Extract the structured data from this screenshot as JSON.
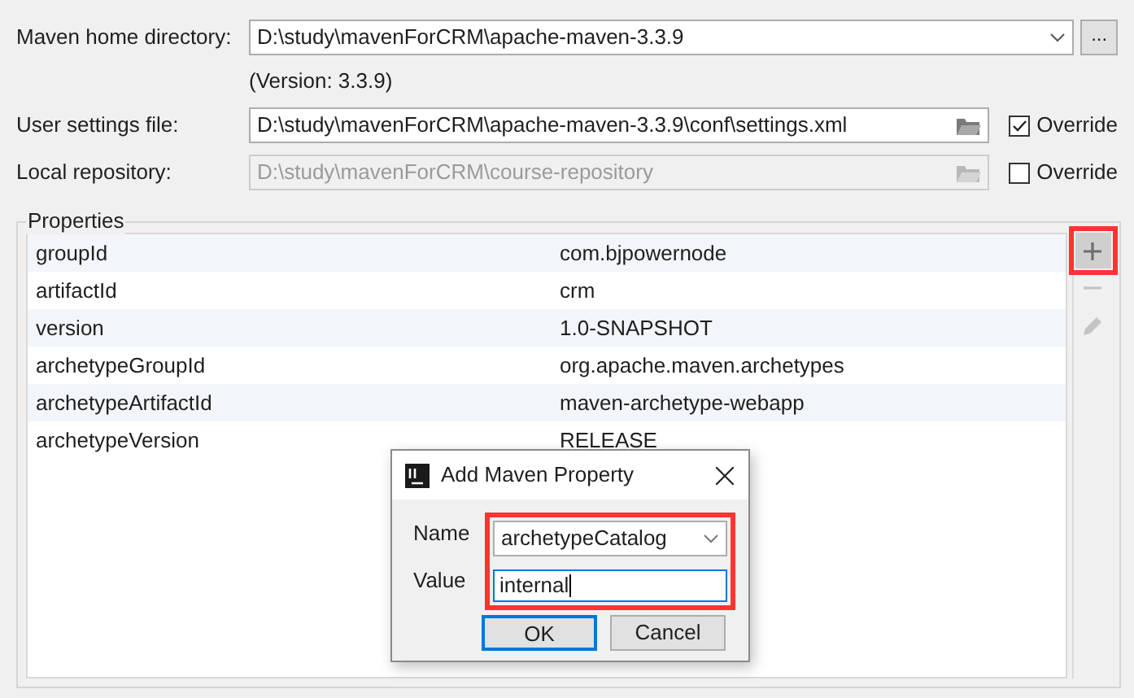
{
  "maven_home": {
    "label": "Maven home directory:",
    "value": "D:\\study\\mavenForCRM\\apache-maven-3.3.9",
    "browse": "..."
  },
  "version": "(Version: 3.3.9)",
  "user_settings": {
    "label": "User settings file:",
    "value": "D:\\study\\mavenForCRM\\apache-maven-3.3.9\\conf\\settings.xml",
    "disabled": false,
    "override": {
      "label": "Override",
      "checked": true
    }
  },
  "local_repository": {
    "label": "Local repository:",
    "value": "D:\\study\\mavenForCRM\\course-repository",
    "disabled": true,
    "override": {
      "label": "Override",
      "checked": false
    }
  },
  "properties": {
    "title": "Properties",
    "rows": [
      {
        "name": "groupId",
        "value": "com.bjpowernode"
      },
      {
        "name": "artifactId",
        "value": "crm"
      },
      {
        "name": "version",
        "value": "1.0-SNAPSHOT"
      },
      {
        "name": "archetypeGroupId",
        "value": "org.apache.maven.archetypes"
      },
      {
        "name": "archetypeArtifactId",
        "value": "maven-archetype-webapp"
      },
      {
        "name": "archetypeVersion",
        "value": "RELEASE"
      }
    ],
    "toolbar": [
      {
        "kind": "add",
        "disabled": false,
        "highlighted": true
      },
      {
        "kind": "remove",
        "disabled": true,
        "highlighted": false
      },
      {
        "kind": "edit",
        "disabled": true,
        "highlighted": false
      }
    ]
  },
  "dialog": {
    "title": "Add Maven Property",
    "name_label": "Name",
    "name_value": "archetypeCatalog",
    "value_label": "Value",
    "value": "internal",
    "fields_highlighted": true,
    "buttons": [
      {
        "label": "OK",
        "default": true
      },
      {
        "label": "Cancel",
        "default": false
      }
    ]
  }
}
